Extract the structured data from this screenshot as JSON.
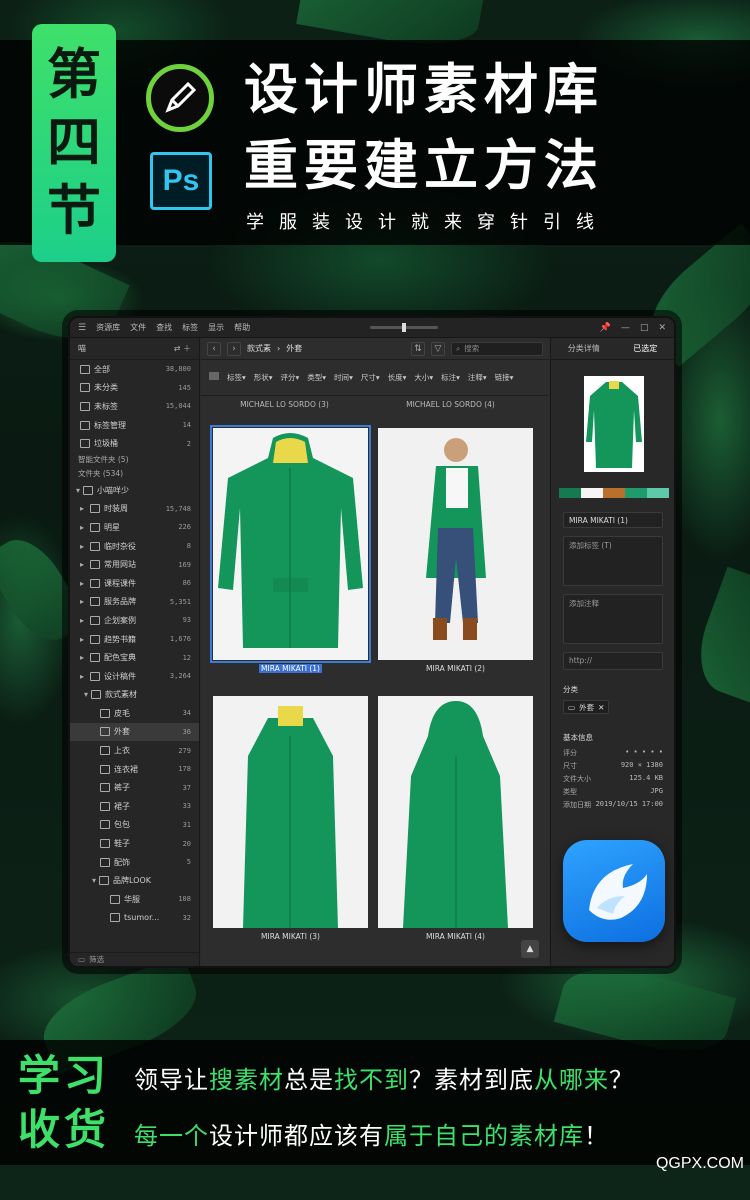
{
  "header": {
    "badge": [
      "第",
      "四",
      "节"
    ],
    "title_line1": "设计师素材库",
    "title_line2": "重要建立方法",
    "subtitle": "学服装设计就来穿针引线",
    "ps_label": "Ps"
  },
  "app": {
    "menu": [
      "资源库",
      "文件",
      "查找",
      "标签",
      "显示",
      "帮助"
    ],
    "sidebar": {
      "library_name": "喵",
      "top_items": [
        {
          "label": "全部",
          "count": "38,800"
        },
        {
          "label": "未分类",
          "count": "145"
        },
        {
          "label": "未标签",
          "count": "15,044"
        },
        {
          "label": "标签管理",
          "count": "14"
        },
        {
          "label": "垃圾桶",
          "count": "2"
        }
      ],
      "smart_folders": "智能文件夹 (5)",
      "folders_label": "文件夹 (534)",
      "root_folder": "小喵咩少",
      "folders": [
        {
          "label": "时装周",
          "count": "15,748"
        },
        {
          "label": "明星",
          "count": "226"
        },
        {
          "label": "临时杂役",
          "count": "8"
        },
        {
          "label": "常用网站",
          "count": "169"
        },
        {
          "label": "课程课件",
          "count": "86"
        },
        {
          "label": "服务品牌",
          "count": "5,351"
        },
        {
          "label": "企划案例",
          "count": "93"
        },
        {
          "label": "趋势书籍",
          "count": "1,676"
        },
        {
          "label": "配色宝典",
          "count": "12"
        },
        {
          "label": "设计稿件",
          "count": "3,264"
        }
      ],
      "style_folder": "款式素材",
      "style_children": [
        {
          "label": "皮毛",
          "count": "34"
        },
        {
          "label": "外套",
          "count": "36"
        },
        {
          "label": "上衣",
          "count": "279"
        },
        {
          "label": "连衣裙",
          "count": "178"
        },
        {
          "label": "裤子",
          "count": "37"
        },
        {
          "label": "裙子",
          "count": "33"
        },
        {
          "label": "包包",
          "count": "31"
        },
        {
          "label": "鞋子",
          "count": "20"
        },
        {
          "label": "配饰",
          "count": "5"
        }
      ],
      "brand_folder": "品牌LOOK",
      "brand_children": [
        {
          "label": "华服",
          "count": "108"
        },
        {
          "label": "tsumor...",
          "count": "32"
        }
      ],
      "filter_label": "筛选"
    },
    "main": {
      "crumb_parent": "款式素",
      "crumb_current": "外套",
      "search_placeholder": "搜索",
      "filters": [
        "标签",
        "形状",
        "评分",
        "类型",
        "时间",
        "尺寸",
        "长度",
        "大小",
        "标注",
        "注释",
        "链接"
      ],
      "prev_labels": [
        "MICHAEL LO SORDO (3)",
        "MICHAEL LO SORDO (4)"
      ],
      "items": [
        {
          "caption": "MIRA MIKATI (1)"
        },
        {
          "caption": "MIRA MIKATI (2)"
        },
        {
          "caption": "MIRA MIKATI (3)"
        },
        {
          "caption": "MIRA MIKATI (4)"
        }
      ]
    },
    "inspector": {
      "tab_category": "分类详情",
      "tab_selected": "已选定",
      "palette": [
        "#157a52",
        "#f5f5f5",
        "#b9702c",
        "#1f9a6a",
        "#5fc8a8"
      ],
      "name": "MIRA MIKATI (1)",
      "tags_placeholder": "添加标签 (T)",
      "notes_placeholder": "添加注释",
      "url_placeholder": "http://",
      "category_label": "分类",
      "category_chip": "外套",
      "basic_info": "基本信息",
      "info": [
        {
          "k": "评分",
          "v": "• • • • •"
        },
        {
          "k": "尺寸",
          "v": "920 × 1380"
        },
        {
          "k": "文件大小",
          "v": "125.4 KB"
        },
        {
          "k": "类型",
          "v": "JPG"
        },
        {
          "k": "添加日期",
          "v": "2019/10/15 17:00"
        }
      ]
    }
  },
  "footer": {
    "learn1": "学习",
    "learn2": "收货",
    "line1": {
      "a": "领导让",
      "b": "搜素材",
      "c": "总是",
      "d": "找不到",
      "e": "？素材到底",
      "f": "从哪来",
      "g": "？"
    },
    "line2": {
      "a": "每一个",
      "b": "设计师都应该有",
      "c": "属于自己的素材库",
      "d": "！"
    },
    "site": "QGPX.COM"
  },
  "colors": {
    "accent": "#3fe06a",
    "coat_green": "#14955a",
    "select_blue": "#3b7cd8"
  }
}
